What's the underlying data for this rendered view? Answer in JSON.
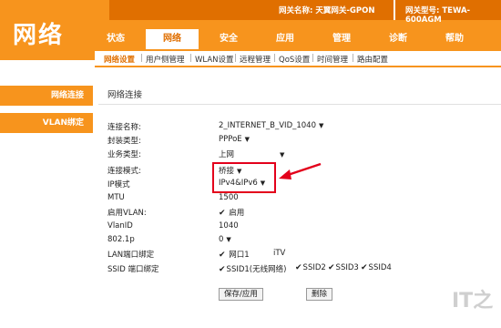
{
  "header": {
    "logo": "网络",
    "gateway_name": "网关名称: 天翼网关-GPON",
    "gateway_model": "网关型号: TEWA-600AGM"
  },
  "nav": [
    "状态",
    "网络",
    "安全",
    "应用",
    "管理",
    "诊断",
    "帮助"
  ],
  "subnav": [
    "网络设置",
    "用户侧管理",
    "WLAN设置",
    "远程管理",
    "QoS设置",
    "时间管理",
    "路由配置"
  ],
  "sidebar": [
    "网络连接",
    "VLAN绑定"
  ],
  "content": {
    "title": "网络连接",
    "fields": {
      "conn_name_label": "连接名称:",
      "conn_name_value": "2_INTERNET_B_VID_1040",
      "encap_label": "封装类型:",
      "encap_value": "PPPoE",
      "service_label": "业务类型:",
      "service_value": "上网",
      "conn_mode_label": "连接模式:",
      "conn_mode_value": "桥接",
      "ip_mode_label": "IP模式",
      "ip_mode_value": "IPv4&IPv6",
      "mtu_label": "MTU",
      "mtu_value": "1500",
      "vlan_enable_label": "启用VLAN:",
      "vlan_enable_value": "启用",
      "vlanid_label": "VlanID",
      "vlanid_value": "1040",
      "p8021_label": "802.1p",
      "p8021_value": "0",
      "lan_bind_label": "LAN端口绑定",
      "lan_bind_port1": "网口1",
      "lan_bind_itv": "iTV",
      "ssid_bind_label": "SSID 端口绑定",
      "ssid_items": [
        "SSID1(无线网络)",
        "SSID2",
        "SSID3",
        "SSID4"
      ]
    },
    "save_label": "保存/应用",
    "delete_label": "删除"
  },
  "watermark": "IT之",
  "colors": {
    "accent": "#f7941d",
    "accent_dark": "#e06f00",
    "highlight": "#e3001b"
  }
}
